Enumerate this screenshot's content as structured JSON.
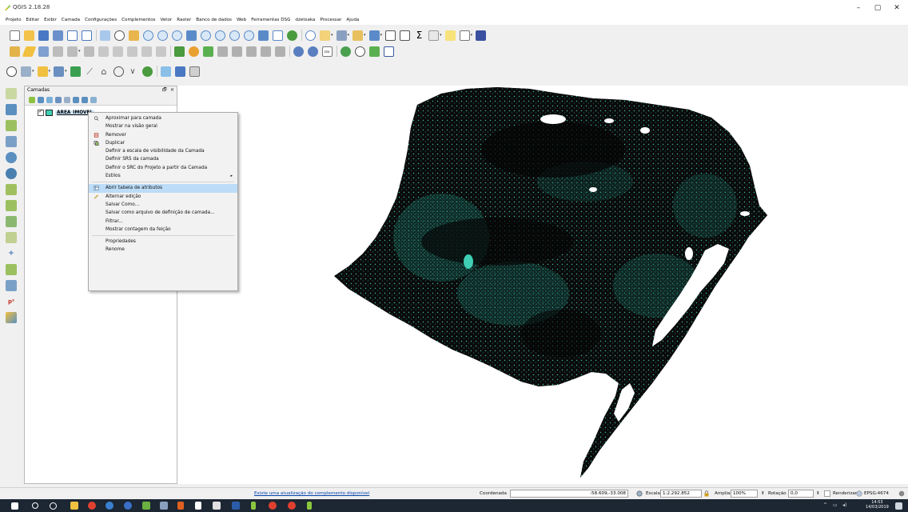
{
  "window": {
    "title": "QGIS 2.18.28",
    "minimize": "–",
    "maximize": "▢",
    "close": "✕"
  },
  "menu": [
    "Projeto",
    "Editar",
    "Exibir",
    "Camada",
    "Configurações",
    "Complementos",
    "Vetor",
    "Raster",
    "Banco de dados",
    "Web",
    "Ferramentas DSG",
    "dzetsaka",
    "Processar",
    "Ajuda"
  ],
  "panel": {
    "title": "Camadas",
    "float_btn": "🗗",
    "close_btn": "✕",
    "layer_name": "AREA_IMOVEL"
  },
  "context_menu": {
    "items": [
      {
        "label": "Aproximar para camada",
        "icon": "zoom-icon"
      },
      {
        "label": "Mostrar na visão geral",
        "icon": ""
      },
      {
        "label": "Remover",
        "icon": "remove-icon"
      },
      {
        "label": "Duplicar",
        "icon": "duplicate-icon"
      },
      {
        "label": "Definir a escala de visibilidade da Camada",
        "icon": ""
      },
      {
        "label": "Definir SRS da camada",
        "icon": ""
      },
      {
        "label": "Definir o SRC do Projeto a partir da Camada",
        "icon": ""
      },
      {
        "label": "Estilos",
        "icon": "",
        "submenu": "▸"
      },
      {
        "label": "Abrir tabela de atributos",
        "icon": "table-icon",
        "highlighted": true
      },
      {
        "label": "Alternar edição",
        "icon": "pencil-icon"
      },
      {
        "label": "Salvar Como...",
        "icon": ""
      },
      {
        "label": "Salvar como arquivo de definição de camada...",
        "icon": ""
      },
      {
        "label": "Filtrar...",
        "icon": ""
      },
      {
        "label": "Mostrar contagem da feição",
        "icon": ""
      },
      {
        "label": "Propriedades",
        "icon": ""
      },
      {
        "label": "Renome",
        "icon": ""
      }
    ]
  },
  "status": {
    "update_msg": "Existe uma atualização do complemento disponível",
    "coord_label": "Coordenada",
    "coord_value": "-58.609,-33.008",
    "scale_label": "Escala",
    "scale_value": "1:2.292.852",
    "zoom_label": "Ampliar",
    "zoom_value": "100%",
    "rotation_label": "Rotação",
    "rotation_value": "0,0",
    "render_label": "Renderizar",
    "crs": "EPSG:4674"
  },
  "taskbar": {
    "time": "14:53",
    "date": "14/03/2019"
  },
  "colors": {
    "map_fill": "#0b0b0b",
    "map_teal": "#3ecfb5",
    "highlight": "#bcdcf7"
  }
}
